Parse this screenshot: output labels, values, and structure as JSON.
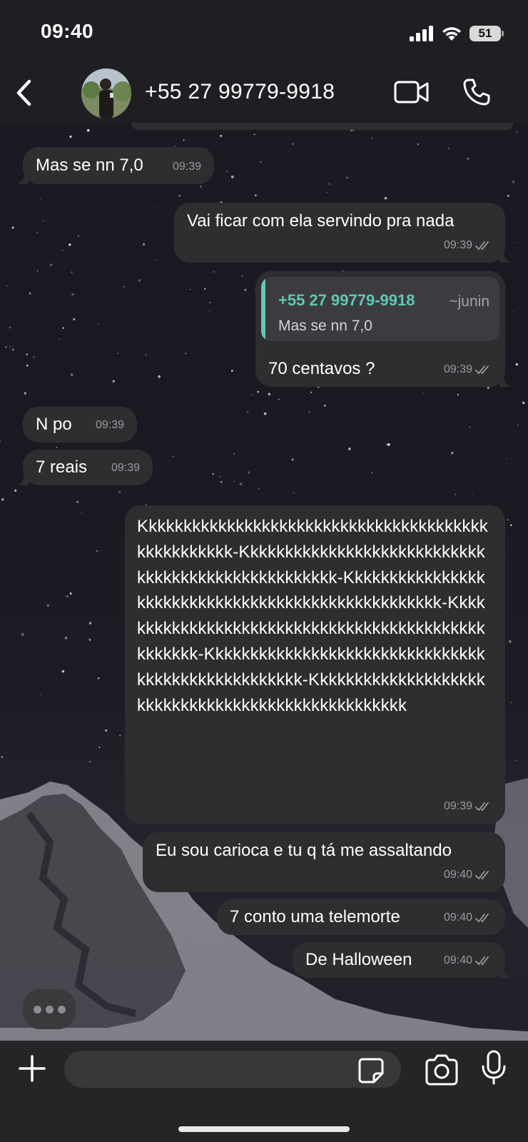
{
  "status_bar": {
    "time": "09:40",
    "battery": "51",
    "icons": [
      "signal-icon",
      "wifi-icon",
      "battery-icon"
    ]
  },
  "header": {
    "contact_name": "+55 27 99779-9918",
    "icons": [
      "back-chevron-icon",
      "avatar",
      "video-camera-icon",
      "phone-icon"
    ]
  },
  "messages": [
    {
      "direction": "incoming",
      "text": "Mas se nn 7,0",
      "time": "09:39"
    },
    {
      "direction": "outgoing",
      "text": "Vai ficar com ela servindo pra nada",
      "time": "09:39",
      "read": true
    },
    {
      "direction": "outgoing",
      "quote": {
        "sender": "+55 27 99779-9918",
        "alias": "~junin",
        "text": "Mas se nn 7,0"
      },
      "text": "70 centavos ?",
      "time": "09:39",
      "read": true
    },
    {
      "direction": "incoming",
      "text": "N po",
      "time": "09:39"
    },
    {
      "direction": "incoming",
      "text": "7 reais",
      "time": "09:39"
    },
    {
      "direction": "outgoing",
      "text": "Kkkkkkkkkkkkkkkkkkkkkkkkkkkkkkkkkkkkkkkkkkkkkkkkkkk-Kkkkkkkkkkkkkkkkkkkkkkkkkkkkkkkkkkkkkkkkkkkkkkkkkkk-Kkkkkkkkkkkkkkkkkkkkkkkkkkkkkkkkkkkkkkkkkkkkkkkkkkk-Kkkkkkkkkkkkkkkkkkkkkkkkkkkkkkkkkkkkkkkkkkkkkkkkkkk-Kkkkkkkkkkkkkkkkkkkkkkkkkkkkkkkkkkkkkkkkkkkkkkkkkkk-Kkkkkkkkkkkkkkkkkkkkkkkkkkkkkkkkkkkkkkkkkkkkkkkkkkk",
      "time": "09:39",
      "read": true
    },
    {
      "direction": "outgoing",
      "text": "Eu sou carioca e tu q tá me assaltando",
      "time": "09:40",
      "read": true
    },
    {
      "direction": "outgoing",
      "text": "7 conto uma telemorte",
      "time": "09:40",
      "read": true
    },
    {
      "direction": "outgoing",
      "text": "De Halloween",
      "time": "09:40",
      "read": true
    }
  ],
  "input_bar": {
    "placeholder": "",
    "icons": [
      "plus-icon",
      "sticker-icon",
      "camera-icon",
      "microphone-icon"
    ]
  },
  "colors": {
    "bubble": "#2e2e31",
    "quote_accent": "#5fc9b5",
    "bar_background": "#1f1f23",
    "meta_text": "#9b9b9f"
  }
}
